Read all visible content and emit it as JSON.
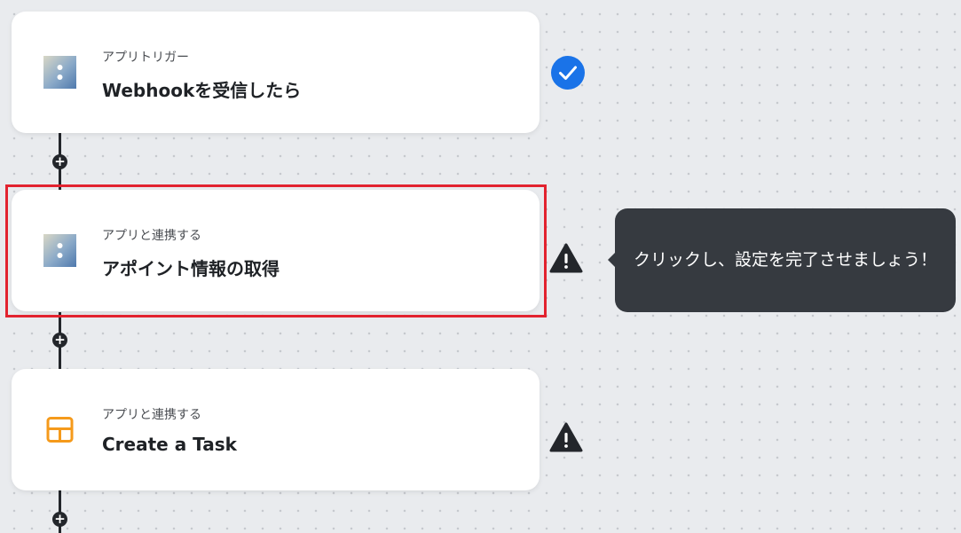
{
  "flow": {
    "steps": [
      {
        "category": "アプリトリガー",
        "title": "Webhookを受信したら",
        "icon": "webhook-app-icon",
        "status": "complete",
        "status_icon": "checkmark-icon"
      },
      {
        "category": "アプリと連携する",
        "title": "アポイント情報の取得",
        "icon": "app-connect-icon",
        "status": "warning",
        "status_icon": "warning-icon",
        "highlighted": true
      },
      {
        "category": "アプリと連携する",
        "title": "Create a Task",
        "icon": "layout-panel-icon",
        "status": "warning",
        "status_icon": "warning-icon"
      }
    ],
    "add_step_label": "+"
  },
  "tooltip": {
    "text": "クリックし、設定を完了させましょう！"
  },
  "colors": {
    "background": "#e9ebee",
    "connector": "#23262b",
    "check_badge": "#1a73e8",
    "warning": "#23262b",
    "highlight_frame": "#e2232f",
    "tooltip_bg": "#363a40",
    "task_icon": "#f59a1b"
  }
}
